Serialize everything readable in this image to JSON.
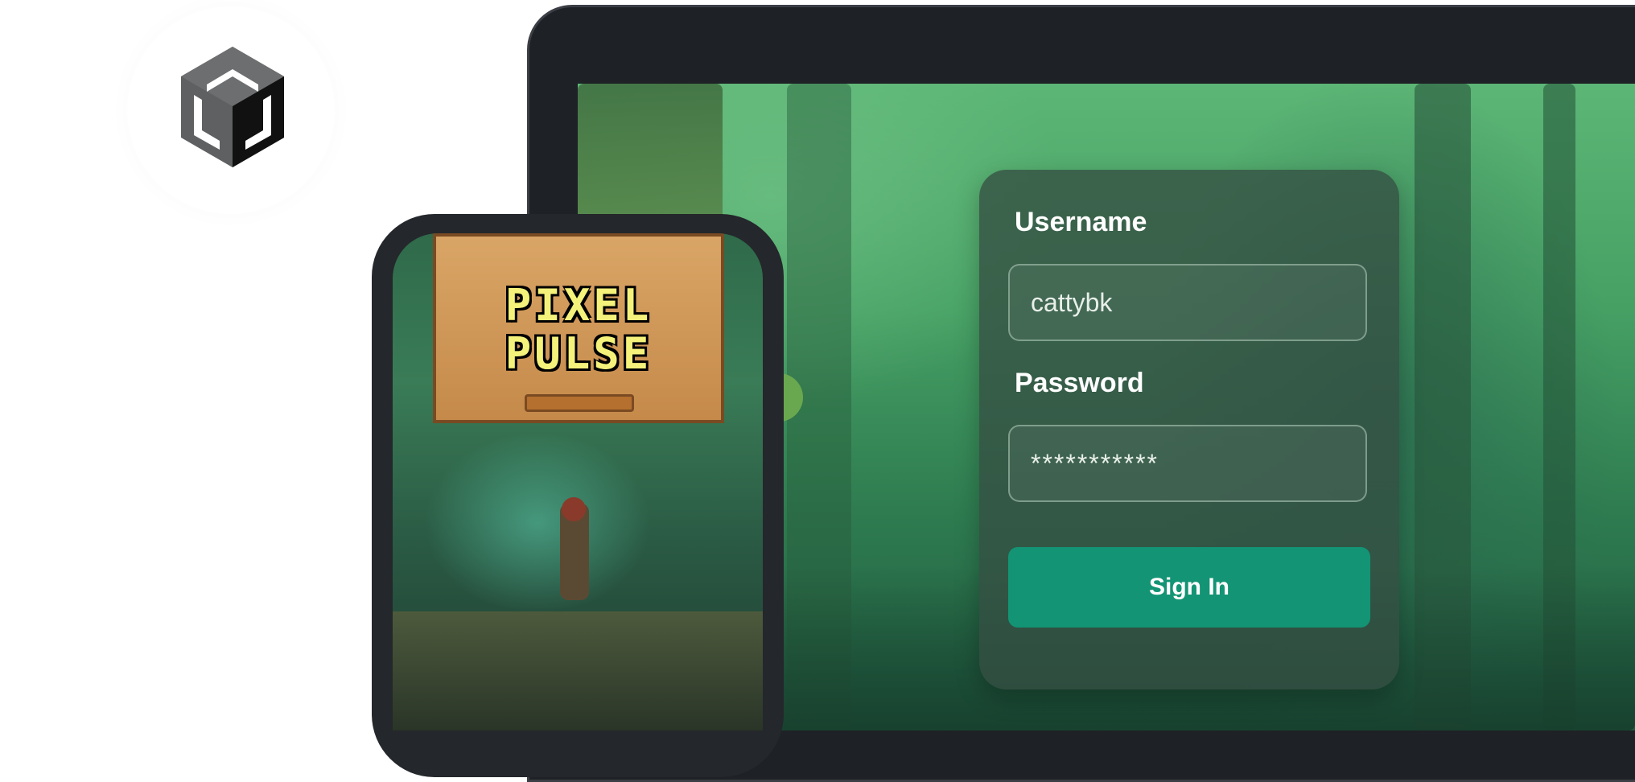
{
  "brand": {
    "logo_icon": "unity-cube-icon"
  },
  "login": {
    "username_label": "Username",
    "username_value": "cattybk",
    "password_label": "Password",
    "password_value": "***********",
    "signin_label": "Sign In",
    "accent_color": "#139474"
  },
  "game": {
    "title_line1": "PIXEL",
    "title_line2": "PULSE"
  }
}
